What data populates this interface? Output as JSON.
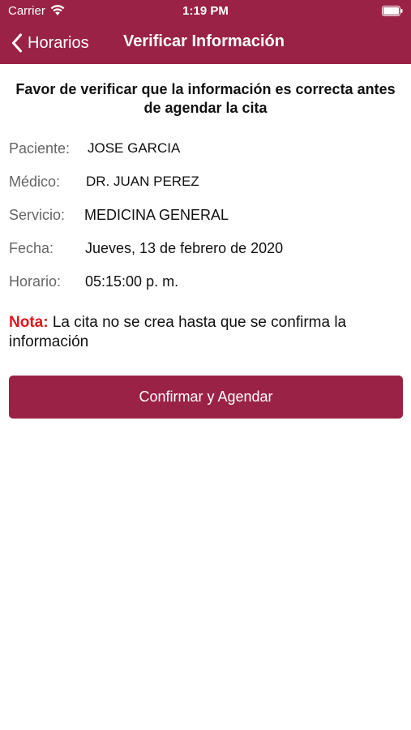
{
  "status_bar": {
    "carrier": "Carrier",
    "time": "1:19 PM",
    "icons": [
      "wifi-icon",
      "battery-icon"
    ]
  },
  "nav": {
    "back_label": "Horarios",
    "title": "Verificar Información"
  },
  "heading": "Favor de verificar que la información es correcta antes de agendar la cita",
  "details": {
    "paciente": {
      "label": "Paciente:",
      "value": "JOSE GARCIA"
    },
    "medico": {
      "label": "Médico:",
      "value": "DR. JUAN PEREZ"
    },
    "servicio": {
      "label": "Servicio:",
      "value": "MEDICINA GENERAL"
    },
    "fecha": {
      "label": "Fecha:",
      "value": "Jueves, 13 de febrero de 2020"
    },
    "horario": {
      "label": "Horario:",
      "value": "05:15:00 p. m."
    }
  },
  "note": {
    "label": "Nota:",
    "text": " La cita no se crea hasta que se confirma la información"
  },
  "confirm_button": "Confirmar y Agendar",
  "colors": {
    "brand": "#9b2247",
    "note_label": "#e0151f",
    "label_gray": "#666666"
  }
}
